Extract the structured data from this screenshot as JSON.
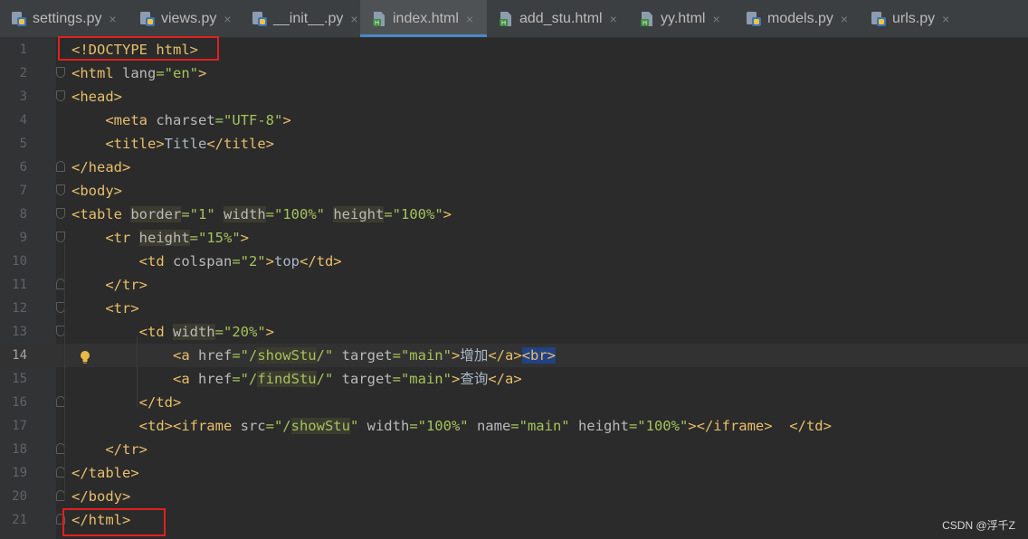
{
  "tabs": [
    {
      "label": "settings.py",
      "icon": "python-file-icon",
      "active": false
    },
    {
      "label": "views.py",
      "icon": "python-file-icon",
      "active": false
    },
    {
      "label": "__init__.py",
      "icon": "python-file-icon",
      "active": false
    },
    {
      "label": "index.html",
      "icon": "html-file-icon",
      "active": true
    },
    {
      "label": "add_stu.html",
      "icon": "html-file-icon",
      "active": false
    },
    {
      "label": "yy.html",
      "icon": "html-file-icon",
      "active": false
    },
    {
      "label": "models.py",
      "icon": "python-file-icon",
      "active": false
    },
    {
      "label": "urls.py",
      "icon": "python-file-icon",
      "active": false
    }
  ],
  "close_glyph": "×",
  "colors": {
    "tag": "#e8bf6a",
    "attr": "#bababa",
    "value": "#a5c25c",
    "text": "#a9b7c6",
    "highlight_box": "#e0201e",
    "active_tab_underline": "#4a88c7"
  },
  "editor": {
    "caret_line": 14,
    "lines": [
      {
        "n": "1",
        "fold": "",
        "tokens": [
          {
            "c": "t",
            "s": "<!DOCTYPE html>"
          }
        ]
      },
      {
        "n": "2",
        "fold": "start",
        "tokens": [
          {
            "c": "t",
            "s": "<html "
          },
          {
            "c": "a",
            "s": "lang"
          },
          {
            "c": "v",
            "s": "=\"en\""
          },
          {
            "c": "t",
            "s": ">"
          }
        ]
      },
      {
        "n": "3",
        "fold": "start",
        "tokens": [
          {
            "c": "t",
            "s": "<head>"
          }
        ]
      },
      {
        "n": "4",
        "fold": "",
        "tokens": [
          {
            "c": "x",
            "s": "    "
          },
          {
            "c": "t",
            "s": "<meta "
          },
          {
            "c": "a",
            "s": "charset"
          },
          {
            "c": "v",
            "s": "=\"UTF-8\""
          },
          {
            "c": "t",
            "s": ">"
          }
        ]
      },
      {
        "n": "5",
        "fold": "",
        "tokens": [
          {
            "c": "x",
            "s": "    "
          },
          {
            "c": "t",
            "s": "<title>"
          },
          {
            "c": "x",
            "s": "Title"
          },
          {
            "c": "t",
            "s": "</title>"
          }
        ]
      },
      {
        "n": "6",
        "fold": "end",
        "tokens": [
          {
            "c": "t",
            "s": "</head>"
          }
        ]
      },
      {
        "n": "7",
        "fold": "start",
        "tokens": [
          {
            "c": "t",
            "s": "<body>"
          }
        ]
      },
      {
        "n": "8",
        "fold": "start",
        "tokens": [
          {
            "c": "t",
            "s": "<table "
          },
          {
            "c": "a hl",
            "s": "border"
          },
          {
            "c": "v",
            "s": "=\"1\" "
          },
          {
            "c": "a hl",
            "s": "width"
          },
          {
            "c": "v",
            "s": "=\"100%\" "
          },
          {
            "c": "a hl",
            "s": "height"
          },
          {
            "c": "v",
            "s": "=\"100%\""
          },
          {
            "c": "t",
            "s": ">"
          }
        ]
      },
      {
        "n": "9",
        "fold": "start",
        "tokens": [
          {
            "c": "x",
            "s": "    "
          },
          {
            "c": "t",
            "s": "<tr "
          },
          {
            "c": "a hl",
            "s": "height"
          },
          {
            "c": "v",
            "s": "=\"15%\""
          },
          {
            "c": "t",
            "s": ">"
          }
        ]
      },
      {
        "n": "10",
        "fold": "",
        "tokens": [
          {
            "c": "x",
            "s": "        "
          },
          {
            "c": "t",
            "s": "<td "
          },
          {
            "c": "a",
            "s": "colspan"
          },
          {
            "c": "v",
            "s": "=\"2\""
          },
          {
            "c": "t",
            "s": ">"
          },
          {
            "c": "x",
            "s": "top"
          },
          {
            "c": "t",
            "s": "</td>"
          }
        ]
      },
      {
        "n": "11",
        "fold": "end",
        "tokens": [
          {
            "c": "x",
            "s": "    "
          },
          {
            "c": "t",
            "s": "</tr>"
          }
        ]
      },
      {
        "n": "12",
        "fold": "start",
        "tokens": [
          {
            "c": "x",
            "s": "    "
          },
          {
            "c": "t",
            "s": "<tr>"
          }
        ]
      },
      {
        "n": "13",
        "fold": "start",
        "tokens": [
          {
            "c": "x",
            "s": "        "
          },
          {
            "c": "t",
            "s": "<td "
          },
          {
            "c": "a hl",
            "s": "width"
          },
          {
            "c": "v",
            "s": "=\"20%\""
          },
          {
            "c": "t",
            "s": ">"
          }
        ]
      },
      {
        "n": "14",
        "fold": "",
        "tokens": [
          {
            "c": "x",
            "s": "            "
          },
          {
            "c": "t",
            "s": "<a "
          },
          {
            "c": "a",
            "s": "href"
          },
          {
            "c": "v",
            "s": "=\"/"
          },
          {
            "c": "v hl",
            "s": "showStu"
          },
          {
            "c": "v",
            "s": "/\" "
          },
          {
            "c": "a",
            "s": "target"
          },
          {
            "c": "v",
            "s": "=\"main\""
          },
          {
            "c": "t",
            "s": ">"
          },
          {
            "c": "x",
            "s": "增加"
          },
          {
            "c": "t",
            "s": "</a>"
          },
          {
            "c": "t brh",
            "s": "<br>"
          }
        ]
      },
      {
        "n": "15",
        "fold": "",
        "tokens": [
          {
            "c": "x",
            "s": "            "
          },
          {
            "c": "t",
            "s": "<a "
          },
          {
            "c": "a",
            "s": "href"
          },
          {
            "c": "v",
            "s": "=\"/"
          },
          {
            "c": "v hl",
            "s": "findStu"
          },
          {
            "c": "v",
            "s": "/\" "
          },
          {
            "c": "a",
            "s": "target"
          },
          {
            "c": "v",
            "s": "=\"main\""
          },
          {
            "c": "t",
            "s": ">"
          },
          {
            "c": "x",
            "s": "查询"
          },
          {
            "c": "t",
            "s": "</a>"
          }
        ]
      },
      {
        "n": "16",
        "fold": "end",
        "tokens": [
          {
            "c": "x",
            "s": "        "
          },
          {
            "c": "t",
            "s": "</td>"
          }
        ]
      },
      {
        "n": "17",
        "fold": "",
        "tokens": [
          {
            "c": "x",
            "s": "        "
          },
          {
            "c": "t",
            "s": "<td><iframe "
          },
          {
            "c": "a",
            "s": "src"
          },
          {
            "c": "v",
            "s": "=\"/"
          },
          {
            "c": "v hl",
            "s": "showStu"
          },
          {
            "c": "v",
            "s": "\" "
          },
          {
            "c": "a",
            "s": "width"
          },
          {
            "c": "v",
            "s": "=\"100%\" "
          },
          {
            "c": "a",
            "s": "name"
          },
          {
            "c": "v",
            "s": "=\"main\" "
          },
          {
            "c": "a",
            "s": "height"
          },
          {
            "c": "v",
            "s": "=\"100%\""
          },
          {
            "c": "t",
            "s": "></iframe>"
          },
          {
            "c": "x",
            "s": "  "
          },
          {
            "c": "t",
            "s": "</td>"
          }
        ]
      },
      {
        "n": "18",
        "fold": "end",
        "tokens": [
          {
            "c": "x",
            "s": "    "
          },
          {
            "c": "t",
            "s": "</tr>"
          }
        ]
      },
      {
        "n": "19",
        "fold": "end",
        "tokens": [
          {
            "c": "t",
            "s": "</table>"
          }
        ]
      },
      {
        "n": "20",
        "fold": "end",
        "tokens": [
          {
            "c": "t",
            "s": "</body>"
          }
        ]
      },
      {
        "n": "21",
        "fold": "end",
        "tokens": [
          {
            "c": "t",
            "s": "</html>"
          }
        ]
      }
    ]
  },
  "watermark": "CSDN @浮千Z"
}
